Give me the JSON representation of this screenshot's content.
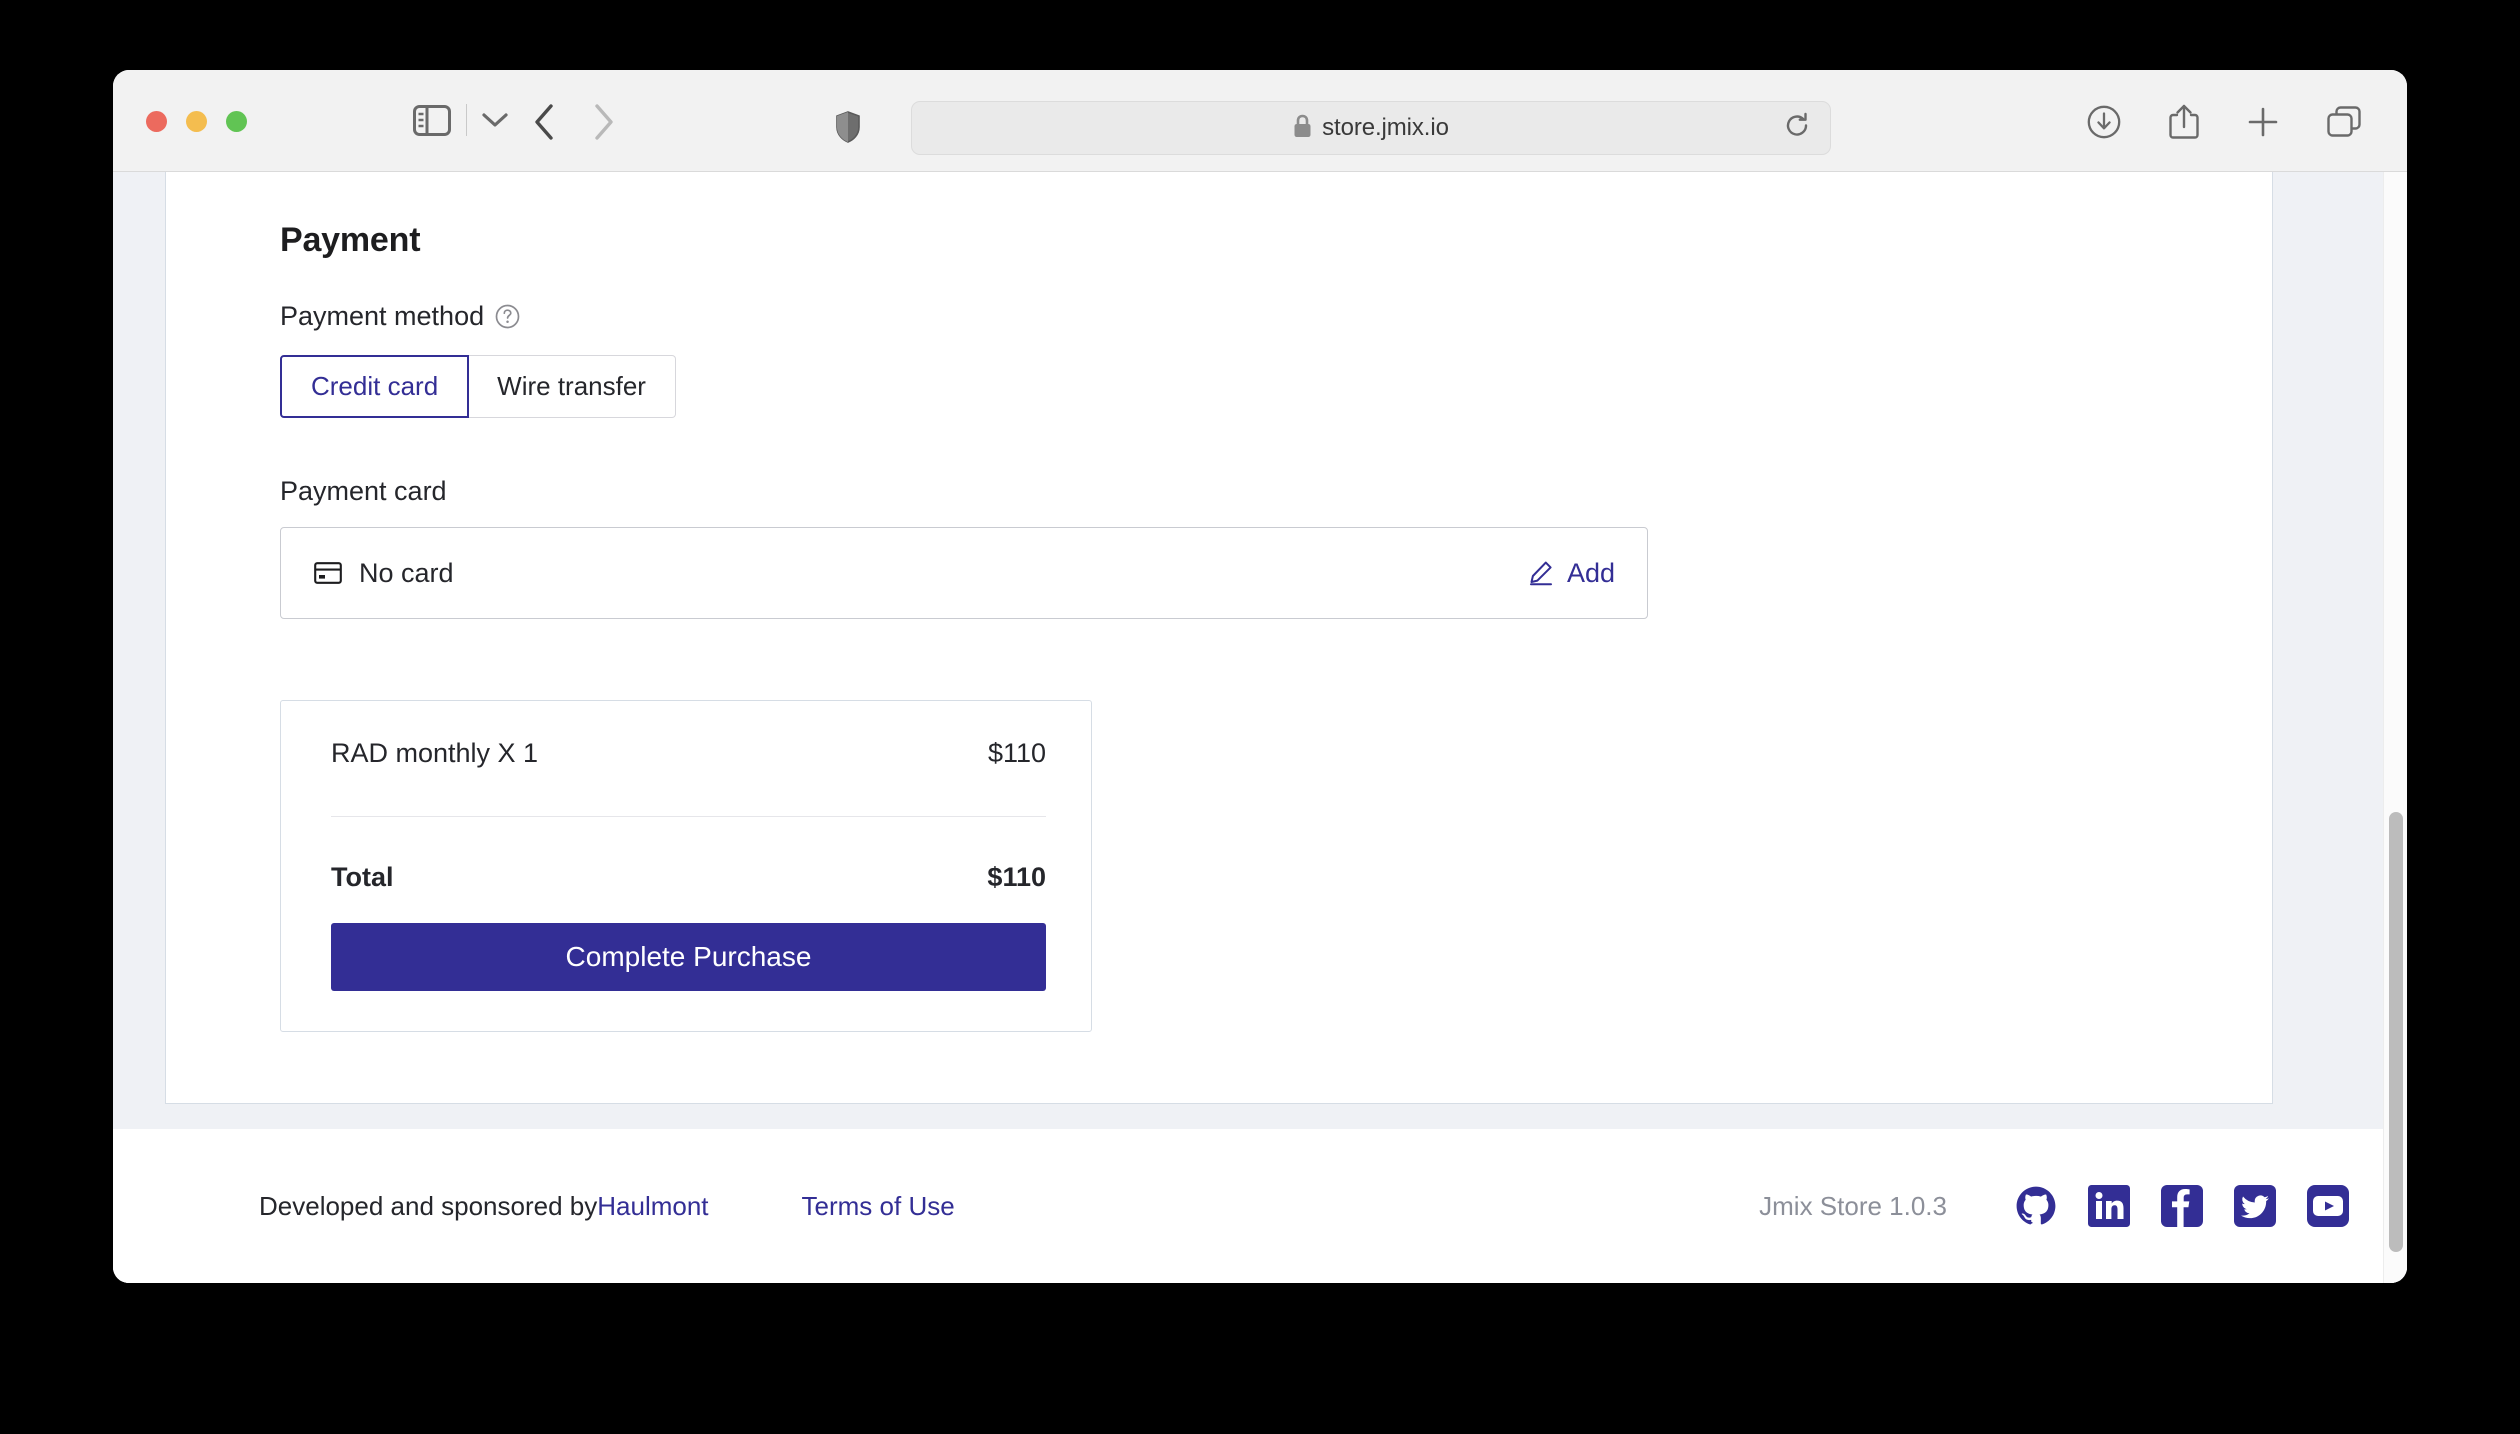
{
  "browser": {
    "url": "store.jmix.io",
    "lock_icon": "lock-icon",
    "reload_icon": "reload-icon",
    "sidebar_icon": "sidebar-toggle-icon",
    "chevron_icon": "chevron-down-icon",
    "back_icon": "back-arrow-icon",
    "forward_icon": "forward-arrow-icon",
    "shield_icon": "shield-icon",
    "download_icon": "download-icon",
    "share_icon": "share-icon",
    "new_tab_icon": "plus-icon",
    "tab_overview_icon": "tab-overview-icon"
  },
  "page": {
    "title": "Payment",
    "payment_method": {
      "label": "Payment method",
      "help_icon": "help-circle-icon",
      "options": [
        {
          "label": "Credit card",
          "selected": true
        },
        {
          "label": "Wire transfer",
          "selected": false
        }
      ]
    },
    "payment_card": {
      "label": "Payment card",
      "card_icon": "credit-card-icon",
      "value": "No card",
      "action_icon": "pencil-icon",
      "action_label": "Add"
    },
    "summary": {
      "line_item_name": "RAD monthly X 1",
      "line_item_price": "$110",
      "total_label": "Total",
      "total_price": "$110",
      "cta_label": "Complete Purchase"
    }
  },
  "footer": {
    "credit_prefix": "Developed and sponsored by ",
    "credit_link": "Haulmont",
    "terms_link": "Terms of Use",
    "version": "Jmix Store 1.0.3",
    "socials": [
      {
        "name": "github-icon"
      },
      {
        "name": "linkedin-icon"
      },
      {
        "name": "facebook-icon"
      },
      {
        "name": "twitter-icon"
      },
      {
        "name": "youtube-icon"
      }
    ]
  },
  "colors": {
    "accent": "#332E95",
    "page_bg": "#EFF1F5",
    "text": "#25262B",
    "muted": "#8C8F99"
  }
}
